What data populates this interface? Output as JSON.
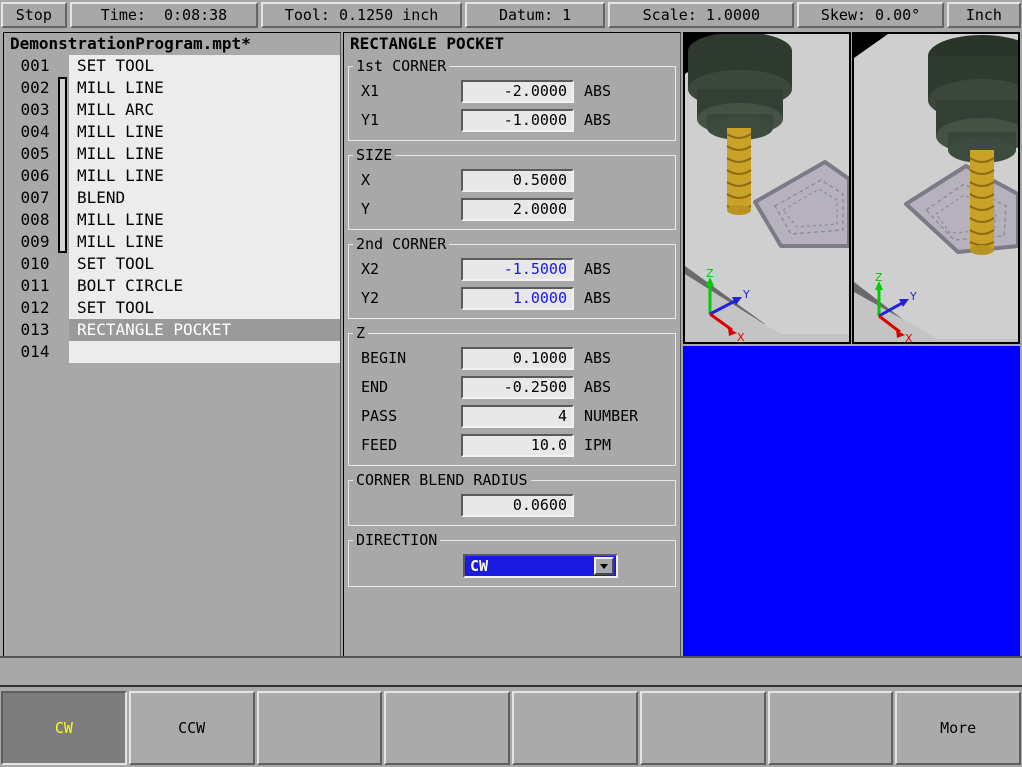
{
  "statusbar": {
    "stop": "Stop",
    "time": "Time:  0:08:38",
    "tool": "Tool: 0.1250 inch",
    "datum": "Datum: 1",
    "scale": "Scale: 1.0000",
    "skew": "Skew: 0.00°",
    "unit": "Inch"
  },
  "program": {
    "filename": "DemonstrationProgram.mpt*",
    "rows": [
      {
        "num": "001",
        "text": "SET TOOL",
        "selected": false
      },
      {
        "num": "002",
        "text": "MILL LINE",
        "selected": false
      },
      {
        "num": "003",
        "text": "MILL ARC",
        "selected": false
      },
      {
        "num": "004",
        "text": "MILL LINE",
        "selected": false
      },
      {
        "num": "005",
        "text": "MILL LINE",
        "selected": false
      },
      {
        "num": "006",
        "text": "MILL LINE",
        "selected": false
      },
      {
        "num": "007",
        "text": "BLEND",
        "selected": false
      },
      {
        "num": "008",
        "text": "MILL LINE",
        "selected": false
      },
      {
        "num": "009",
        "text": "MILL LINE",
        "selected": false
      },
      {
        "num": "010",
        "text": "SET TOOL",
        "selected": false
      },
      {
        "num": "011",
        "text": "BOLT CIRCLE",
        "selected": false
      },
      {
        "num": "012",
        "text": "SET TOOL",
        "selected": false
      },
      {
        "num": "013",
        "text": "RECTANGLE POCKET",
        "selected": true
      },
      {
        "num": "014",
        "text": "",
        "selected": false
      }
    ]
  },
  "params": {
    "title": "RECTANGLE POCKET",
    "groups": [
      {
        "legend": "1st CORNER",
        "fields": [
          {
            "label": "X1",
            "value": "-2.0000",
            "unit": "ABS",
            "computed": false
          },
          {
            "label": "Y1",
            "value": "-1.0000",
            "unit": "ABS",
            "computed": false
          }
        ]
      },
      {
        "legend": "SIZE",
        "fields": [
          {
            "label": "X",
            "value": "0.5000",
            "unit": "",
            "computed": false
          },
          {
            "label": "Y",
            "value": "2.0000",
            "unit": "",
            "computed": false
          }
        ]
      },
      {
        "legend": "2nd CORNER",
        "fields": [
          {
            "label": "X2",
            "value": "-1.5000",
            "unit": "ABS",
            "computed": true
          },
          {
            "label": "Y2",
            "value": "1.0000",
            "unit": "ABS",
            "computed": true
          }
        ]
      },
      {
        "legend": "Z",
        "fields": [
          {
            "label": "BEGIN",
            "value": "0.1000",
            "unit": "ABS",
            "computed": false
          },
          {
            "label": "END",
            "value": "-0.2500",
            "unit": "ABS",
            "computed": false
          },
          {
            "label": "PASS",
            "value": "4",
            "unit": "NUMBER",
            "computed": false
          },
          {
            "label": "FEED",
            "value": "10.0",
            "unit": "IPM",
            "computed": false
          }
        ]
      }
    ],
    "corner_blend_radius": {
      "legend": "CORNER BLEND RADIUS",
      "value": "0.0600"
    },
    "direction": {
      "legend": "DIRECTION",
      "selected": "CW",
      "options": [
        "CW",
        "CCW"
      ]
    }
  },
  "softkeys": [
    {
      "label": "CW",
      "active": true
    },
    {
      "label": "CCW",
      "active": false
    },
    {
      "label": "",
      "active": false
    },
    {
      "label": "",
      "active": false
    },
    {
      "label": "",
      "active": false
    },
    {
      "label": "",
      "active": false
    },
    {
      "label": "",
      "active": false
    },
    {
      "label": "More",
      "active": false
    }
  ],
  "preview": {
    "axis_labels": {
      "z": "Z",
      "y": "Y",
      "x": "X"
    },
    "colors": {
      "z_axis": "#00cc00",
      "y_axis": "#2222dd",
      "x_axis": "#dd0000"
    }
  },
  "colors": {
    "panel_bg": "#a8a8a8",
    "field_bg": "#e8e8e8",
    "computed_text": "#1818ee",
    "selection_bg": "#9a9a9a",
    "dropdown_bg": "#1a1ae0",
    "blue_area": "#0000ff",
    "softkey_active_text": "#ffff00"
  }
}
